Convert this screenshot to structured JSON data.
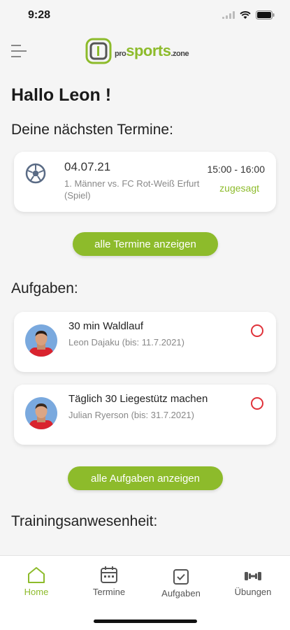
{
  "status": {
    "time": "9:28"
  },
  "logo": {
    "pro": "pro",
    "sports": "sports",
    "zone": ".zone"
  },
  "greeting": "Hallo Leon !",
  "events": {
    "title": "Deine nächsten Termine:",
    "items": [
      {
        "date": "04.07.21",
        "description": "1. Männer vs. FC Rot-Weiß Erfurt (Spiel)",
        "time": "15:00 - 16:00",
        "status": "zugesagt",
        "icon": "soccer-ball-icon"
      }
    ],
    "show_all": "alle Termine anzeigen"
  },
  "tasks": {
    "title": "Aufgaben:",
    "items": [
      {
        "title": "30 min Waldlauf",
        "subtitle": "Leon Dajaku (bis: 11.7.2021)"
      },
      {
        "title": "Täglich 30 Liegestütz machen",
        "subtitle": "Julian Ryerson (bis: 31.7.2021)"
      }
    ],
    "show_all": "alle Aufgaben anzeigen"
  },
  "attendance": {
    "title": "Trainingsanwesenheit:"
  },
  "tabs": [
    {
      "label": "Home",
      "icon": "home-icon",
      "active": true
    },
    {
      "label": "Termine",
      "icon": "calendar-icon",
      "active": false
    },
    {
      "label": "Aufgaben",
      "icon": "checkbox-icon",
      "active": false
    },
    {
      "label": "Übungen",
      "icon": "dumbbell-icon",
      "active": false
    }
  ],
  "colors": {
    "accent": "#8dbb2b",
    "danger": "#e0323a",
    "background": "#f5f5f5"
  }
}
